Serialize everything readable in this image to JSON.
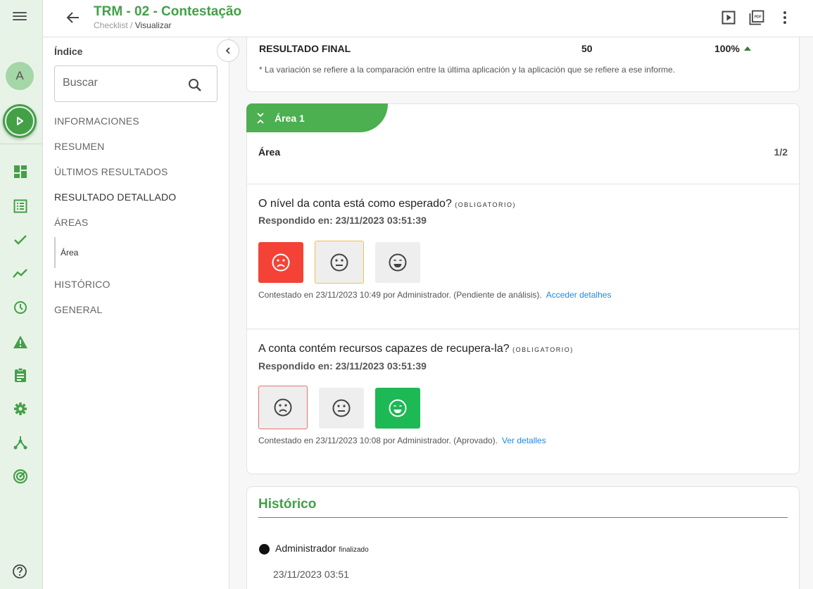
{
  "app": {
    "title": "TRM - 02 - Contestação",
    "breadcrumb": {
      "parent": "Checklist",
      "separator": "/",
      "current": "Visualizar"
    },
    "accent_color": "#43a047"
  },
  "rail": {
    "avatar_letter": "A",
    "icons": [
      "menu-icon",
      "play-icon",
      "dashboard-icon",
      "list-icon",
      "check-icon",
      "trending-icon",
      "clock-icon",
      "warning-icon",
      "clipboard-icon",
      "gear-icon",
      "network-icon",
      "radar-icon",
      "help-icon"
    ]
  },
  "toolbar": {
    "icons": [
      "play-box-icon",
      "pdf-icon",
      "more-vert-icon"
    ]
  },
  "index": {
    "title": "Índice",
    "search_placeholder": "Buscar",
    "items": [
      "INFORMACIONES",
      "RESUMEN",
      "ÚLTIMOS RESULTADOS",
      "RESULTADO DETALLADO",
      "ÁREAS",
      "HISTÓRICO",
      "GENERAL"
    ],
    "sub_item": "Área"
  },
  "result": {
    "label": "RESULTADO FINAL",
    "value": "50",
    "percent": "100%",
    "note": "* La variación se refiere a la comparación entre la última aplicación y la aplicación que se refiere a ese informe."
  },
  "area": {
    "tab_label": "Área 1",
    "name": "Área",
    "page": "1/2",
    "questions": [
      {
        "text": "O nível da conta está como esperado?",
        "required": "(OBLIGATORIO)",
        "responded": "Respondido en: 23/11/2023 03:51:39",
        "answer_text": "Contestado en 23/11/2023 10:49 por Administrador. (Pendiente de análisis).",
        "link": "Acceder detalhes"
      },
      {
        "text": "A conta contém recursos capazes de recupera-la?",
        "required": "(OBLIGATORIO)",
        "responded": "Respondido en: 23/11/2023 03:51:39",
        "answer_text": "Contestado en 23/11/2023 10:08 por Administrador. (Aprovado).",
        "link": "Ver detalles"
      }
    ]
  },
  "history": {
    "title": "Histórico",
    "entries": [
      {
        "user": "Administrador",
        "status": "finalizado",
        "date": "23/11/2023 03:51"
      }
    ]
  }
}
